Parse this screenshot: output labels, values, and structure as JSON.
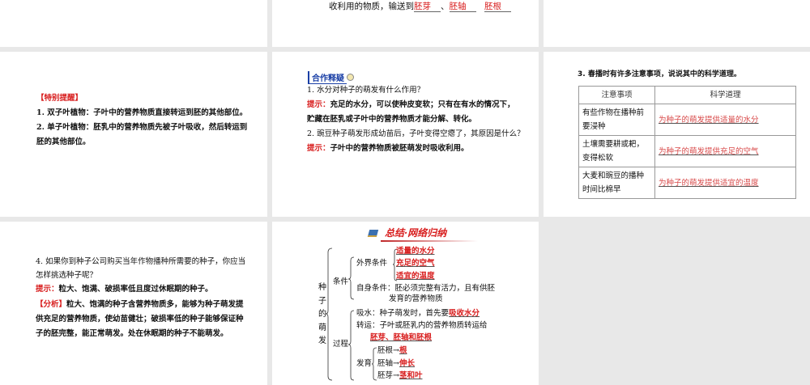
{
  "slide_top_mid": {
    "text": "收利用的物质，输送到",
    "answers": [
      "胚芽",
      "胚轴",
      "胚根"
    ],
    "sep": "、"
  },
  "slide_reminder": {
    "title": "【特别提醒】",
    "lines": [
      "1. 双子叶植物：子叶中的营养物质直接转运到胚的其他部位。",
      "2. 单子叶植物：胚乳中的营养物质先被子叶吸收，然后转运到",
      "胚的其他部位。"
    ]
  },
  "slide_coop": {
    "heading": "合作释疑",
    "q1": "1. 水分对种子的萌发有什么作用？",
    "hint_label": "提示：",
    "a1_line1": "充足的水分，可以使种皮变软；只有在有水的情况下，",
    "a1_line2": "贮藏在胚乳或子叶中的营养物质才能分解、转化。",
    "q2": "2. 豌豆种子萌发形成幼苗后，子叶变得空瘪了，其原因是什么？",
    "a2": "子叶中的营养物质被胚萌发时吸收利用。"
  },
  "slide_table": {
    "question": "3. 春播时有许多注意事项，说说其中的科学道理。",
    "headers": [
      "注意事项",
      "科学道理"
    ],
    "rows": [
      {
        "item": "有些作物在播种前要浸种",
        "reason": "为种子的萌发提供适量的水分"
      },
      {
        "item": "土壤需要耕或耙，变得松软",
        "reason": "为种子的萌发提供充足的空气"
      },
      {
        "item": "大麦和豌豆的播种时间比棉早",
        "reason": "为种子的萌发提供适宜的温度"
      }
    ]
  },
  "slide_q4": {
    "q_line1": "4. 如果你到种子公司购买当年作物播种所需要的种子，你应当",
    "q_line2": "怎样挑选种子呢？",
    "hint_label": "提示：",
    "hint": "粒大、饱满、破损率低且度过休眠期的种子。",
    "analysis_label": "【分析】",
    "analysis_line1": "粒大、饱满的种子含营养物质多，能够为种子萌发提",
    "analysis_line2": "供充足的营养物质，使幼苗健壮；破损率低的种子能够保证种",
    "analysis_line3": "子的胚完整，能正常萌发。处在休眠期的种子不能萌发。"
  },
  "slide_summary": {
    "title": "总结·网络归纳",
    "root": [
      "种",
      "子",
      "的",
      "萌",
      "发"
    ],
    "conditions": "条件",
    "external": "外界条件",
    "external_items": [
      "适量的水分",
      "充足的空气",
      "适宜的温度"
    ],
    "self_line1": "自身条件：胚必须完整有活力，且有供胚",
    "self_line2": "发育的营养物质",
    "process": "过程",
    "absorb_prefix": "吸水：种子萌发时，首先要",
    "absorb_answer": "吸收水分",
    "transport": "转运：子叶或胚乳内的营养物质转运给",
    "transport_answer": "胚芽、胚轴和胚根",
    "develop": "发育",
    "develop_items": [
      {
        "from": "胚根",
        "to": "根"
      },
      {
        "from": "胚轴",
        "to": "伸长"
      },
      {
        "from": "胚芽",
        "to": "茎和叶"
      }
    ],
    "arrow": "→"
  }
}
